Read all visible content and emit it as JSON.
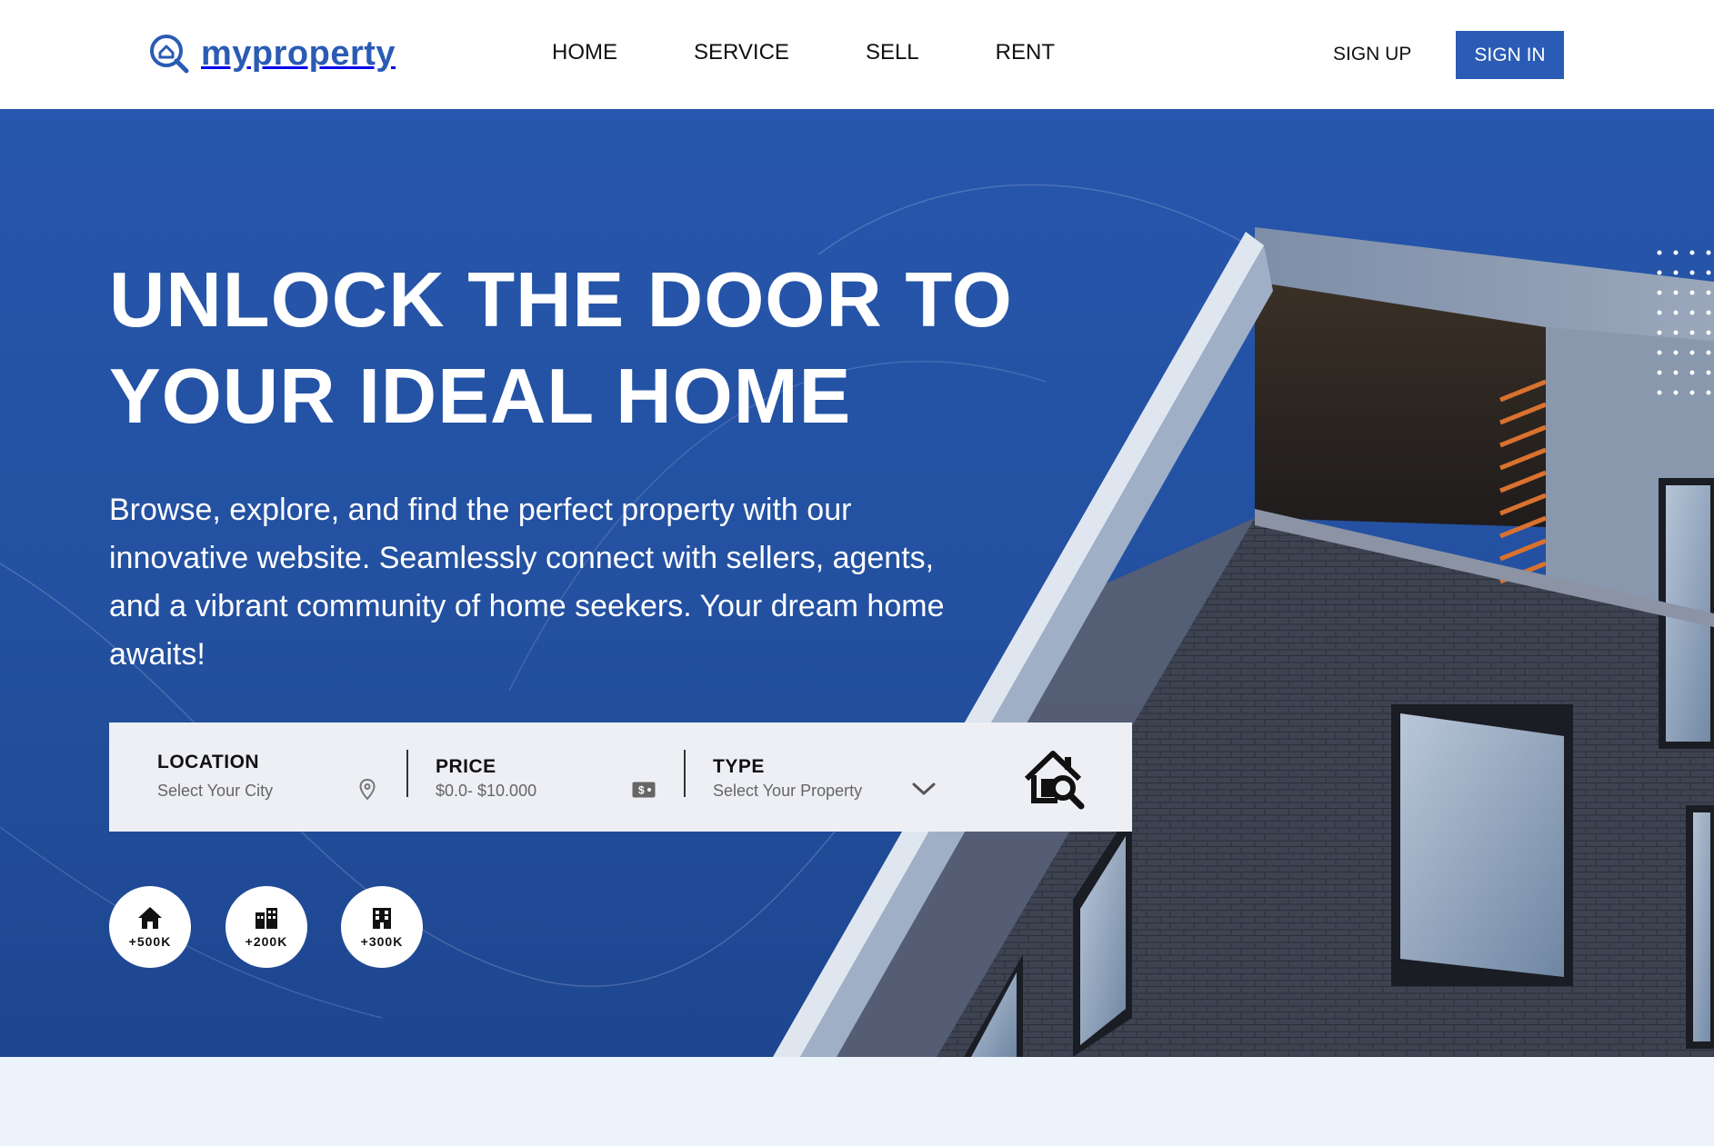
{
  "brand": {
    "name": "myproperty",
    "color": "#2a5bb5",
    "icon": "house-search-icon"
  },
  "nav": {
    "items": [
      {
        "label": "HOME"
      },
      {
        "label": "SERVICE"
      },
      {
        "label": "SELL"
      },
      {
        "label": "RENT"
      }
    ],
    "signup_label": "SIGN UP",
    "signin_label": "SIGN IN"
  },
  "hero": {
    "title_line1": "UNLOCK THE DOOR TO",
    "title_line2": "YOUR IDEAL HOME",
    "description": "Browse, explore, and find the perfect property with our innovative website. Seamlessly connect with sellers, agents, and a vibrant community of home seekers. Your dream home awaits!",
    "background": "#2656ad"
  },
  "search": {
    "location": {
      "label": "LOCATION",
      "value": "Select Your City",
      "icon": "map-pin-icon"
    },
    "price": {
      "label": "PRICE",
      "value": "$0.0- $10.000",
      "icon": "money-icon"
    },
    "type": {
      "label": "TYPE",
      "value": "Select Your Property",
      "icon": "chevron-down-icon"
    },
    "button_icon": "house-search-icon"
  },
  "stats": [
    {
      "icon": "house-icon",
      "value": "+500K"
    },
    {
      "icon": "buildings-icon",
      "value": "+200K"
    },
    {
      "icon": "apartment-icon",
      "value": "+300K"
    }
  ]
}
